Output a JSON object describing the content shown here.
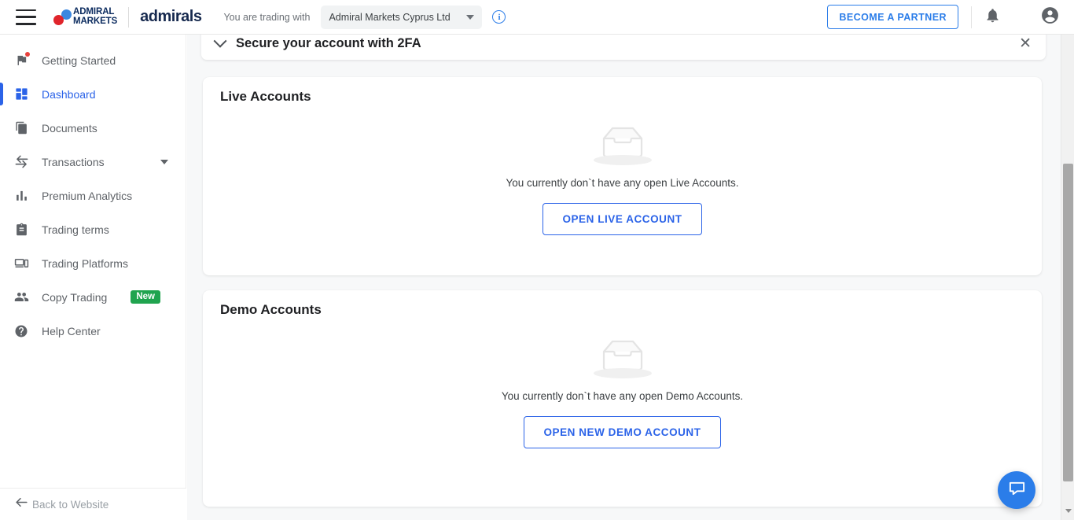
{
  "header": {
    "menu_icon": "hamburger-menu-icon",
    "brand_line1": "ADMIRAL",
    "brand_line2": "MARKETS",
    "product_name": "admirals",
    "trading_with_label": "You are trading with",
    "entity_selected": "Admiral Markets Cyprus Ltd",
    "info_glyph": "i",
    "partner_button": "BECOME A PARTNER",
    "notifications_icon": "bell-icon",
    "account_icon": "account-circle-icon",
    "accent_blue": "#2b7de9"
  },
  "sidebar": {
    "items": [
      {
        "label": "Getting Started",
        "icon": "flag-icon",
        "active": false,
        "has_dot": true
      },
      {
        "label": "Dashboard",
        "icon": "dashboard-grid-icon",
        "active": true,
        "has_dot": false
      },
      {
        "label": "Documents",
        "icon": "documents-copy-icon",
        "active": false,
        "has_dot": false
      },
      {
        "label": "Transactions",
        "icon": "transfer-arrows-icon",
        "active": false,
        "has_dot": false,
        "has_chevron": true
      },
      {
        "label": "Premium Analytics",
        "icon": "bar-chart-icon",
        "active": false,
        "has_dot": false
      },
      {
        "label": "Trading terms",
        "icon": "clipboard-icon",
        "active": false,
        "has_dot": false
      },
      {
        "label": "Trading Platforms",
        "icon": "devices-icon",
        "active": false,
        "has_dot": false
      },
      {
        "label": "Copy Trading",
        "icon": "people-icon",
        "active": false,
        "has_dot": false,
        "badge": "New"
      },
      {
        "label": "Help Center",
        "icon": "help-circle-icon",
        "active": false,
        "has_dot": false
      }
    ],
    "badge_new_label": "New",
    "badge_new_color": "#20a44f",
    "active_color": "#2b63e8",
    "back_to_website": "Back to Website",
    "back_arrow_icon": "arrow-left-icon"
  },
  "banner": {
    "title": "Secure your account with 2FA",
    "expand_icon": "chevron-down-icon",
    "close_icon": "close-icon",
    "close_glyph": "✕"
  },
  "live_accounts": {
    "title": "Live Accounts",
    "empty_icon": "empty-inbox-tray-icon",
    "empty_message": "You currently don`t have any open Live Accounts.",
    "button_label": "OPEN LIVE ACCOUNT"
  },
  "demo_accounts": {
    "title": "Demo Accounts",
    "empty_icon": "empty-inbox-tray-icon",
    "empty_message": "You currently don`t have any open Demo Accounts.",
    "button_label": "OPEN NEW DEMO ACCOUNT"
  },
  "chat": {
    "icon": "chat-bubble-icon",
    "color": "#2b7de9"
  },
  "scrollbar": {
    "arrow_icon": "chevron-down-icon"
  }
}
